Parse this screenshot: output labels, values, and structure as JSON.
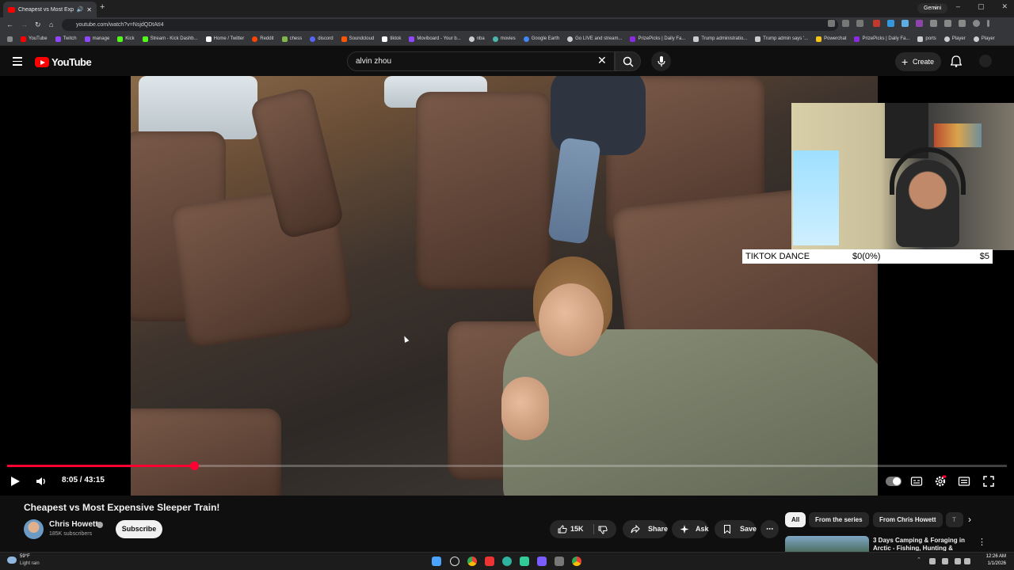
{
  "browser": {
    "tab_title": "Cheapest vs Most Expensi...",
    "new_tab": "+",
    "url": "youtube.com/watch?v=NsjdQDtAtI4",
    "gemini_label": "Gemini",
    "window_controls": [
      "⌄",
      "–",
      "▢",
      "✕"
    ],
    "bookmarks": [
      {
        "label": "YouTube",
        "color": "#ff0000"
      },
      {
        "label": "Twitch",
        "color": "#9146ff"
      },
      {
        "label": "manage",
        "color": "#9146ff"
      },
      {
        "label": "Kick",
        "color": "#53fc18"
      },
      {
        "label": "Stream - Kick Dashb...",
        "color": "#53fc18"
      },
      {
        "label": "Home / Twitter",
        "color": "#ffffff"
      },
      {
        "label": "Reddit",
        "color": "#ff4500"
      },
      {
        "label": "chess",
        "color": "#81b64c"
      },
      {
        "label": "discord",
        "color": "#5865f2"
      },
      {
        "label": "Soundcloud",
        "color": "#ff5500"
      },
      {
        "label": "tiktok",
        "color": "#ffffff"
      },
      {
        "label": "Moviboard - Your b...",
        "color": "#9146ff"
      },
      {
        "label": "nba",
        "color": "#cccccc"
      },
      {
        "label": "movies",
        "color": "#4db6ac"
      },
      {
        "label": "Google Earth",
        "color": "#4285f4"
      },
      {
        "label": "Go LIVE and stream...",
        "color": "#cccccc"
      },
      {
        "label": "PrizePicks | Daily Fa...",
        "color": "#8a2be2"
      },
      {
        "label": "Trump administratio...",
        "color": "#cccccc"
      },
      {
        "label": "Trump admin says '...",
        "color": "#cccccc"
      },
      {
        "label": "Powerchat",
        "color": "#f5c518"
      },
      {
        "label": "PrizePicks | Daily Fa...",
        "color": "#8a2be2"
      },
      {
        "label": "ports",
        "color": "#cccccc"
      },
      {
        "label": "Player",
        "color": "#cccccc"
      },
      {
        "label": "Player",
        "color": "#cccccc"
      }
    ]
  },
  "youtube": {
    "logo_text": "YouTube",
    "search_value": "alvin zhou",
    "create_label": "Create"
  },
  "player": {
    "time": "8:05 / 43:15",
    "progress_fraction": 0.187,
    "cursor_icon": "mouse-pointer-icon"
  },
  "overlay": {
    "goal_title": "TIKTOK DANCE",
    "goal_progress": "$0(0%)",
    "goal_target": "$5"
  },
  "video": {
    "title": "Cheapest vs Most Expensive Sleeper Train!",
    "channel": "Chris Howett",
    "subscribers": "185K subscribers",
    "subscribe_label": "Subscribe",
    "likes": "15K",
    "share_label": "Share",
    "ask_label": "Ask",
    "save_label": "Save"
  },
  "sidebar": {
    "chips": [
      "All",
      "From the series",
      "From Chris Howett",
      "T"
    ],
    "rec_title": "3 Days Camping & Foraging in Arctic - Fishing, Hunting &"
  },
  "taskbar": {
    "weather_temp": "59°F",
    "weather_desc": "Light rain",
    "time": "12:26 AM",
    "date": "1/1/2026"
  }
}
